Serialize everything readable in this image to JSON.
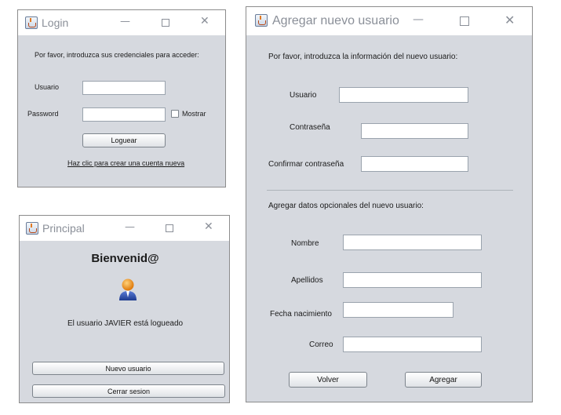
{
  "login": {
    "title": "Login",
    "prompt": "Por favor, introduzca sus credenciales para acceder:",
    "usuario_label": "Usuario",
    "usuario_value": "",
    "password_label": "Password",
    "password_value": "",
    "mostrar_label": "Mostrar",
    "mostrar_checked": false,
    "login_button": "Loguear",
    "create_link": "Haz clic para crear una cuenta nueva"
  },
  "principal": {
    "title": "Principal",
    "welcome": "Bienvenid@",
    "status_text": "El usuario JAVIER está logueado",
    "nuevo_usuario_button": "Nuevo usuario",
    "cerrar_sesion_button": "Cerrar sesion"
  },
  "nuevo_usuario": {
    "title": "Agregar nuevo usuario",
    "prompt": "Por favor, introduzca la información del nuevo usuario:",
    "usuario_label": "Usuario",
    "contrasena_label": "Contraseña",
    "confirmar_label": "Confirmar contraseña",
    "optional_prompt": "Agregar datos opcionales del nuevo usuario:",
    "nombre_label": "Nombre",
    "apellidos_label": "Apellidos",
    "fecha_label": "Fecha nacimiento",
    "correo_label": "Correo",
    "volver_button": "Volver",
    "agregar_button": "Agregar",
    "field_values": {
      "usuario": "",
      "contrasena": "",
      "confirmar": "",
      "nombre": "",
      "apellidos": "",
      "fecha": "",
      "correo": ""
    }
  },
  "window_controls": {
    "minimize": "—",
    "close": "✕"
  },
  "icons": {
    "app": "java-app-icon",
    "user": "user-avatar-icon"
  },
  "colors": {
    "window_bg": "#d6d9df",
    "titlebar_bg": "#ffffff",
    "title_text": "#8a8f98"
  }
}
